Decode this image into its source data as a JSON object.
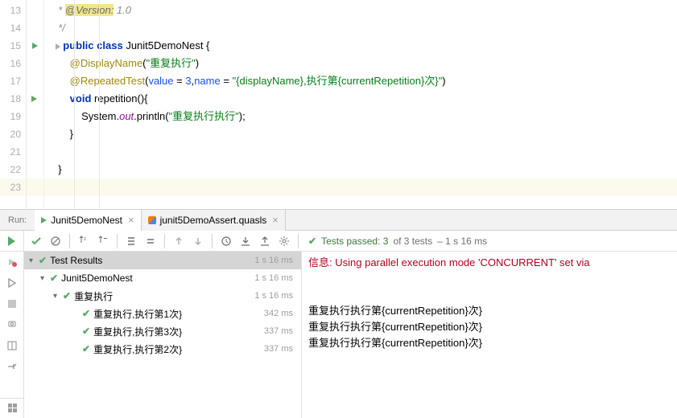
{
  "gutter": {
    "lines": [
      "13",
      "14",
      "15",
      "16",
      "17",
      "18",
      "19",
      "20",
      "21",
      "22",
      "23"
    ]
  },
  "code": {
    "l13_c": "* ",
    "l13_tag": "@Version:",
    "l13_v": " 1.0",
    "l14": "*/",
    "l15_kw1": "public",
    "l15_kw2": "class",
    "l15_name": "Junit5DemoNest",
    "l15_brace": " {",
    "l16_ann": "@DisplayName",
    "l16_str": "\"重复执行\"",
    "l17_ann": "@RepeatedTest",
    "l17_arg1": "value",
    "l17_eq1": " = ",
    "l17_num": "3",
    "l17_comma": ",",
    "l17_arg2": "name",
    "l17_eq2": " = ",
    "l17_str": "\"{displayName},执行第{currentRepetition}次}\"",
    "l18_kw": "void",
    "l18_name": "repetition",
    "l18_paren": "(){",
    "l19_sys": "System.",
    "l19_out": "out",
    "l19_pl": ".println(",
    "l19_str": "\"重复执行执行\"",
    "l19_end": ");",
    "l20": "}",
    "l22": "}"
  },
  "run_label": "Run:",
  "tabs": [
    {
      "label": "Junit5DemoNest",
      "active": true
    },
    {
      "label": "junit5DemoAssert.quasls",
      "active": false
    }
  ],
  "status": {
    "passed": "Tests passed: 3",
    "of": "of 3 tests",
    "time": "– 1 s 16 ms"
  },
  "tree": [
    {
      "label": "Test Results",
      "time": "1 s 16 ms",
      "sel": true,
      "depth": 0,
      "chev": true
    },
    {
      "label": "Junit5DemoNest",
      "time": "1 s 16 ms",
      "depth": 1,
      "chev": true
    },
    {
      "label": "重复执行",
      "time": "1 s 16 ms",
      "depth": 2,
      "chev": true
    },
    {
      "label": "重复执行,执行第1次}",
      "time": "342 ms",
      "depth": 3
    },
    {
      "label": "重复执行,执行第3次}",
      "time": "337 ms",
      "depth": 3
    },
    {
      "label": "重复执行,执行第2次}",
      "time": "337 ms",
      "depth": 3
    }
  ],
  "console": {
    "info_pre": "信息: ",
    "info_msg": "Using parallel execution mode 'CONCURRENT' set via",
    "out1": "重复执行执行第{currentRepetition}次}",
    "out2": "重复执行执行第{currentRepetition}次}",
    "out3": "重复执行执行第{currentRepetition}次}"
  }
}
